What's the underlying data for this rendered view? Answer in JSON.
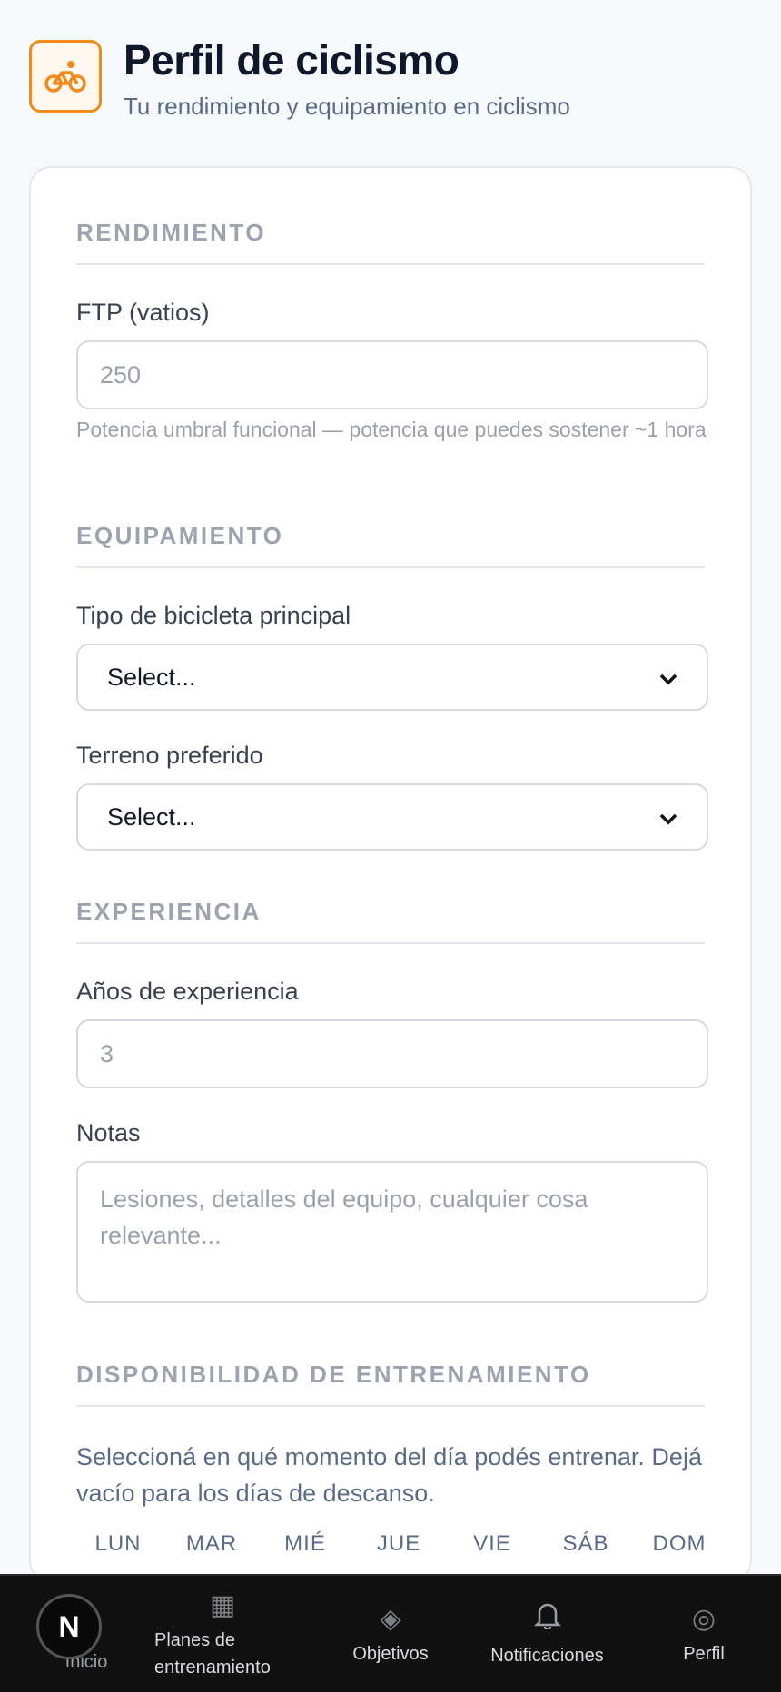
{
  "header": {
    "title": "Perfil de ciclismo",
    "subtitle": "Tu rendimiento y equipamiento en ciclismo",
    "icon": "bicycle-icon",
    "accent": "#f28a1a"
  },
  "sections": {
    "performance": {
      "title": "RENDIMIENTO",
      "ftp_label": "FTP (vatios)",
      "ftp_placeholder": "250",
      "ftp_helper": "Potencia umbral funcional — potencia que puedes sostener ~1 hora"
    },
    "equipment": {
      "title": "EQUIPAMIENTO",
      "bike_label": "Tipo de bicicleta principal",
      "bike_value": "Select...",
      "terrain_label": "Terreno preferido",
      "terrain_value": "Select..."
    },
    "experience": {
      "title": "EXPERIENCIA",
      "years_label": "Años de experiencia",
      "years_placeholder": "3",
      "notes_label": "Notas",
      "notes_placeholder": "Lesiones, detalles del equipo, cualquier cosa relevante..."
    },
    "availability": {
      "title": "DISPONIBILIDAD DE ENTRENAMIENTO",
      "description": "Seleccioná en qué momento del día podés entrenar. Dejá vacío para los días de descanso.",
      "days": [
        "LUN",
        "MAR",
        "MIÉ",
        "JUE",
        "VIE",
        "SÁB",
        "DOM"
      ]
    }
  },
  "nav": {
    "home_badge": "N",
    "home_label": "Inicio",
    "plans_label": "Planes de entrenamiento",
    "goals_label": "Objetivos",
    "notifications_label": "Notificaciones",
    "profile_label": "Perfil"
  }
}
